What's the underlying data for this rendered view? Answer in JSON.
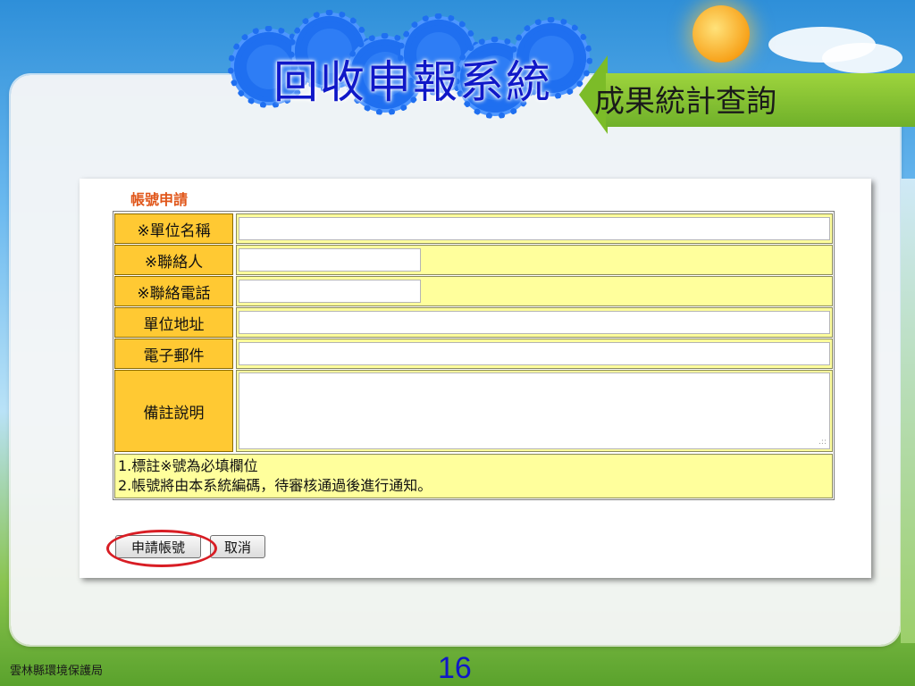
{
  "slide": {
    "title": "回收申報系統",
    "subtitle": "成果統計查詢",
    "organization": "雲林縣環境保護局",
    "page_number": "16"
  },
  "form": {
    "heading": "帳號申請",
    "fields": [
      {
        "label": "※單位名稱",
        "value": ""
      },
      {
        "label": "※聯絡人",
        "value": ""
      },
      {
        "label": "※聯絡電話",
        "value": ""
      },
      {
        "label": "單位地址",
        "value": ""
      },
      {
        "label": "電子郵件",
        "value": ""
      },
      {
        "label": "備註說明",
        "value": ""
      }
    ],
    "notes": [
      "1.標註※號為必填欄位",
      "2.帳號將由本系統編碼，待審核通過後進行通知。"
    ],
    "buttons": {
      "apply": "申請帳號",
      "cancel": "取消"
    }
  },
  "colors": {
    "label_bg": "#ffc933",
    "field_bg": "#ffff9c",
    "heading": "#e0561a",
    "title": "#1018c8",
    "highlight": "#d81d24"
  },
  "icons": [
    "gear-icon",
    "sun-icon",
    "textarea-resize-grip-icon"
  ]
}
